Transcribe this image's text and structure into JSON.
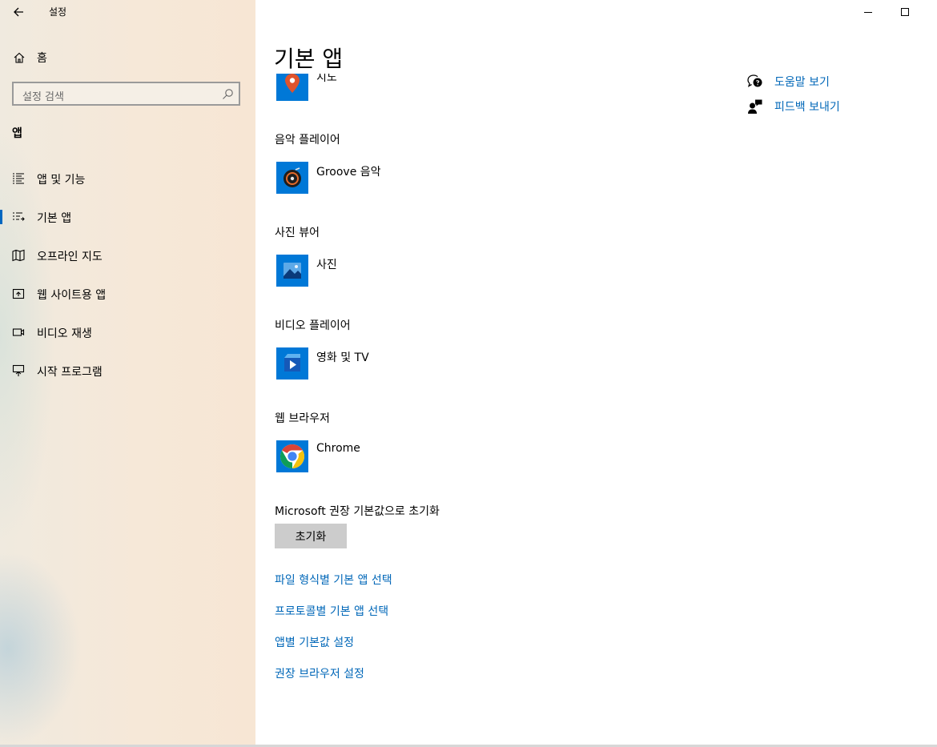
{
  "window": {
    "title": "설정",
    "minimize_icon": "minimize-icon",
    "maximize_icon": "maximize-icon"
  },
  "sidebar": {
    "home_label": "홈",
    "search_placeholder": "설정 검색",
    "section_title": "앱",
    "items": [
      {
        "label": "앱 및 기능",
        "icon": "apps-features-icon"
      },
      {
        "label": "기본 앱",
        "icon": "default-apps-icon",
        "selected": true
      },
      {
        "label": "오프라인 지도",
        "icon": "offline-maps-icon"
      },
      {
        "label": "웹 사이트용 앱",
        "icon": "apps-for-websites-icon"
      },
      {
        "label": "비디오 재생",
        "icon": "video-playback-icon"
      },
      {
        "label": "시작 프로그램",
        "icon": "startup-icon"
      }
    ],
    "accent_color": "#0067c0"
  },
  "main": {
    "title": "기본 앱",
    "partial_top_app": "지도",
    "categories": [
      {
        "label": "음악 플레이어",
        "app": "Groove 음악"
      },
      {
        "label": "사진 뷰어",
        "app": "사진"
      },
      {
        "label": "비디오 플레이어",
        "app": "영화 및 TV"
      },
      {
        "label": "웹 브라우저",
        "app": "Chrome"
      }
    ],
    "reset": {
      "label": "Microsoft 권장 기본값으로 초기화",
      "button": "초기화"
    },
    "links": [
      "파일 형식별 기본 앱 선택",
      "프로토콜별 기본 앱 선택",
      "앱별 기본값 설정",
      "권장 브라우저 설정"
    ],
    "link_color": "#0067b8"
  },
  "help": {
    "get_help": "도움말 보기",
    "give_feedback": "피드백 보내기"
  }
}
